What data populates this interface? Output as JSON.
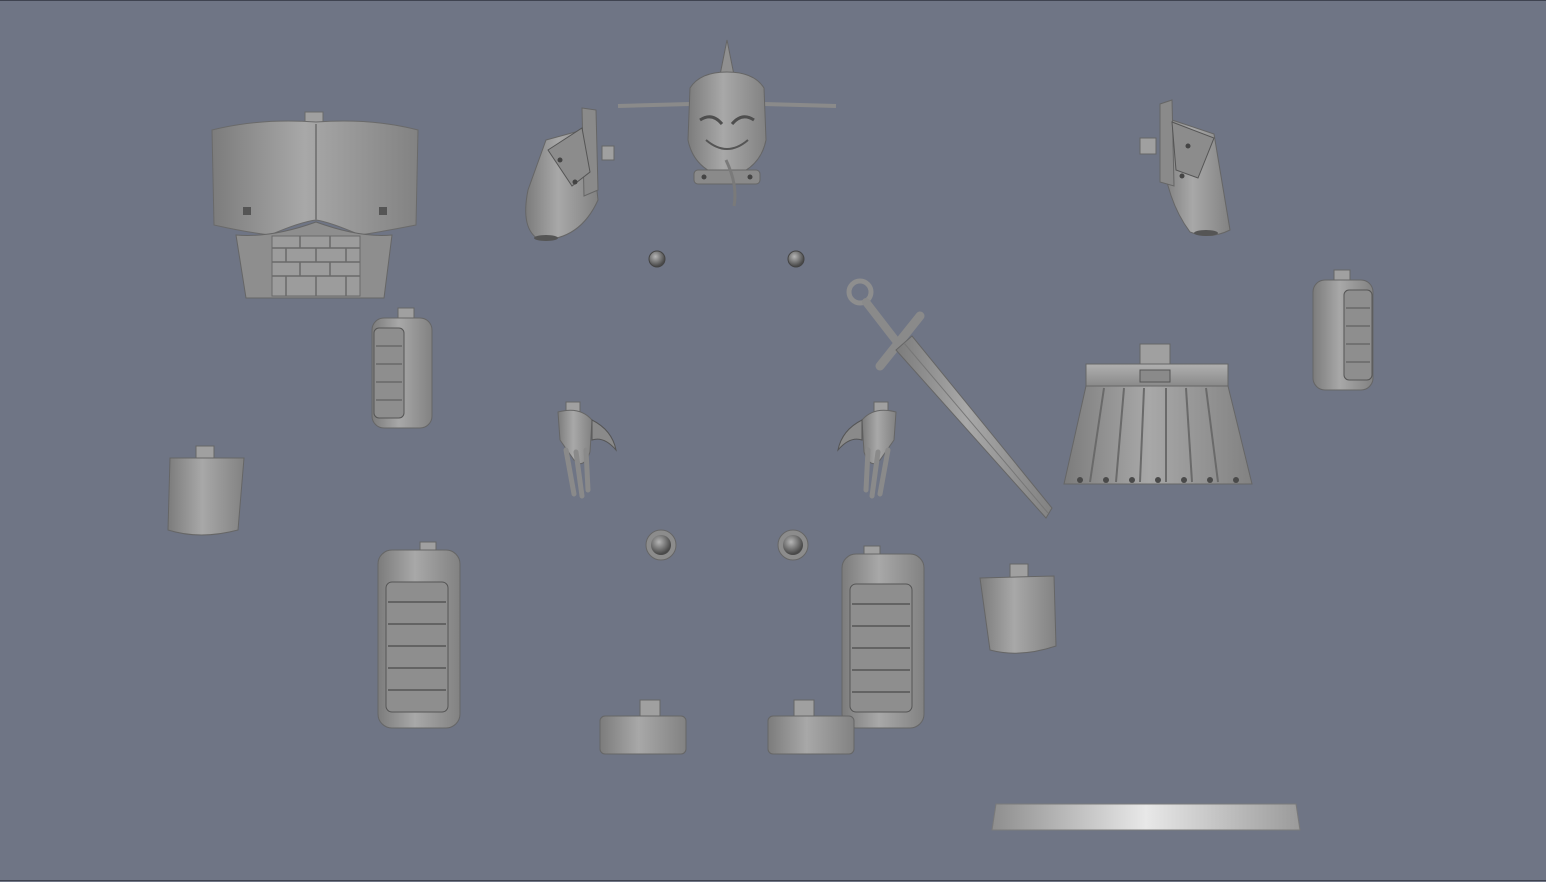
{
  "viewport": {
    "background": "#6f7585",
    "part_color": "#9a9a9a",
    "shadow_color": "#5e5e5e",
    "highlight_color": "#c4c4c4",
    "parts": [
      "chest-plate",
      "helmet-head",
      "left-shoulder-pauldron",
      "right-shoulder-pauldron",
      "neck-joint-left",
      "neck-joint-right",
      "left-upper-arm",
      "right-upper-arm",
      "left-clawed-hand",
      "right-clawed-hand",
      "sword",
      "waist-skirt",
      "left-forearm-cup",
      "right-forearm-cup",
      "hip-ball-joint-left",
      "hip-ball-joint-right",
      "left-leg-greave",
      "right-leg-greave",
      "left-foot-block",
      "right-foot-block",
      "display-base"
    ]
  }
}
